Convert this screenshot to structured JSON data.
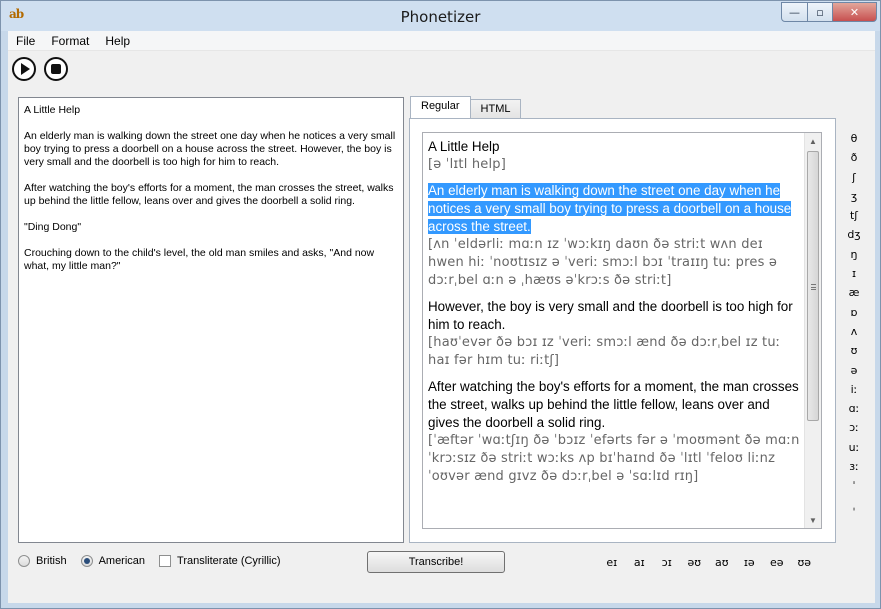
{
  "window": {
    "title": "Phonetizer",
    "icon_label": "ab",
    "controls": {
      "minimize": "—",
      "maximize": "▫",
      "close": "✕"
    }
  },
  "menu": [
    "File",
    "Format",
    "Help"
  ],
  "toolbar": {
    "play_icon": "play-icon",
    "stop_icon": "stop-icon"
  },
  "left_text": {
    "paragraphs": [
      "A Little Help",
      "An elderly man is walking down the street one day when he notices a very small boy trying to press a doorbell on a house across the street. However, the boy is very small and the doorbell is too high for him to reach.",
      "After watching the boy's efforts for a moment, the man crosses the street, walks up behind the little fellow, leans over and gives the doorbell a solid ring.",
      "\"Ding Dong\"",
      "Crouching down to the child's level, the old man smiles and asks, \"And now what, my little man?\""
    ]
  },
  "tabs": [
    {
      "label": "Regular",
      "active": true
    },
    {
      "label": "HTML",
      "active": false
    }
  ],
  "output": {
    "blocks": [
      {
        "en": "A Little Help",
        "ipa": "[ə ˈlɪtl help]",
        "selected": false
      },
      {
        "en": "An elderly man is walking down the street one day when he notices a very small boy trying to press a doorbell on a house across the street.",
        "ipa": "[ʌn ˈeldərliː mɑːn ɪz ˈwɔːkɪŋ daʊn ðə striːt wʌn deɪ hwen hiː ˈnoʊtɪsɪz ə ˈveriː smɔːl bɔɪ ˈtraɪɪŋ tuː pres ə dɔːrˌbel ɑːn ə ˌhæʊs əˈkrɔːs ðə striːt]",
        "selected": true
      },
      {
        "en": "However, the boy is very small and the doorbell is too high for him to reach.",
        "ipa": "[haʊˈevər ðə bɔɪ ɪz ˈveriː smɔːl ænd ðə dɔːrˌbel ɪz tuː haɪ fər hɪm tuː riːtʃ]",
        "selected": false
      },
      {
        "en": "After watching the boy's efforts for a moment, the man crosses the street, walks up behind the little fellow, leans over and gives the doorbell a solid ring.",
        "ipa": "[ˈæftər ˈwɑːtʃɪŋ ðə ˈbɔɪz ˈefərts fər ə ˈmoʊmənt ðə mɑːn ˈkrɔːsɪz ðə striːt wɔːks ʌp bɪˈhaɪnd ðə ˈlɪtl ˈfeloʊ liːnz ˈoʊvər ænd gɪvz ðə dɔːrˌbel ə ˈsɑːlɪd rɪŋ]",
        "selected": false
      }
    ]
  },
  "symbols": [
    "θ",
    "ð",
    "ʃ",
    "ʒ",
    "tʃ",
    "dʒ",
    "ŋ",
    "ɪ",
    "æ",
    "ɒ",
    "ʌ",
    "ʊ",
    "ə",
    "iː",
    "ɑː",
    "ɔː",
    "uː",
    "ɜː",
    "ˈ",
    "ˌ"
  ],
  "bottom": {
    "options": [
      {
        "type": "radio",
        "label": "British",
        "checked": false
      },
      {
        "type": "radio",
        "label": "American",
        "checked": true
      },
      {
        "type": "checkbox",
        "label": "Transliterate (Cyrillic)",
        "checked": false
      }
    ],
    "transcribe_label": "Transcribe!",
    "diphthongs": [
      "eɪ",
      "aɪ",
      "ɔɪ",
      "əʊ",
      "aʊ",
      "ɪə",
      "eə",
      "ʊə"
    ]
  }
}
